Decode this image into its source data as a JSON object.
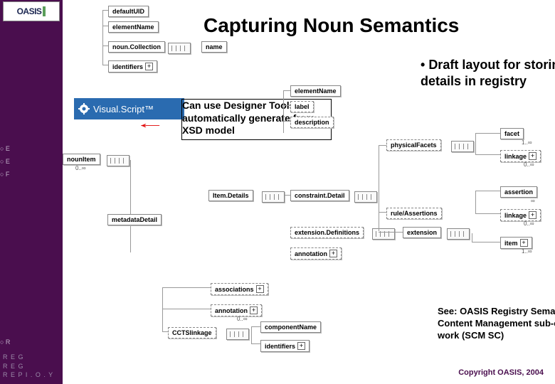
{
  "title": "Capturing Noun Semantics",
  "bullet_right": "Draft layout for storing noun details in registry",
  "callout": "Can use Designer Tools to automatically generate from XSD model",
  "vs_label": "Visual.Script™",
  "note": "See: OASIS Registry Semantic Content Management sub-committee work (SCM SC)",
  "copyright": "Copyright OASIS, 2004",
  "logo_text": "OASIS",
  "registry_text_lines": [
    "R  E  G",
    "R  E  G",
    "R  E  P  I  .  O .  Y"
  ],
  "nodes": {
    "defaultUID": "defaultUID",
    "elementName1": "elementName",
    "nounCollection": "noun.Collection",
    "name": "name",
    "identifiers1": "identifiers",
    "nounItem": "nounItem",
    "itemDetails": "Item.Details",
    "metadataDetail": "metadataDetail",
    "elementName2": "elementName",
    "label": "label",
    "description": "description",
    "constraintDetail": "constraint.Detail",
    "ruleAssertions": "rule/Assertions",
    "extensionDefinitions": "extension.Definitions",
    "extension": "extension",
    "annotation2": "annotation",
    "physicalFacets": "physicalFacets",
    "facet": "facet",
    "linkage1": "linkage",
    "assertion": "assertion",
    "linkage2": "linkage",
    "item": "item",
    "associations": "associations",
    "annotation": "annotation",
    "cctsLinkage": "CCTSlinkage",
    "componentName": "componentName",
    "identifiers2": "identifiers"
  },
  "cards": {
    "nounItem": "0..∞",
    "annotation": "0..∞",
    "facet": "1..∞",
    "linkage1": "0..∞",
    "assertion": "∞",
    "linkage2": "0..∞",
    "item": "1..∞"
  }
}
